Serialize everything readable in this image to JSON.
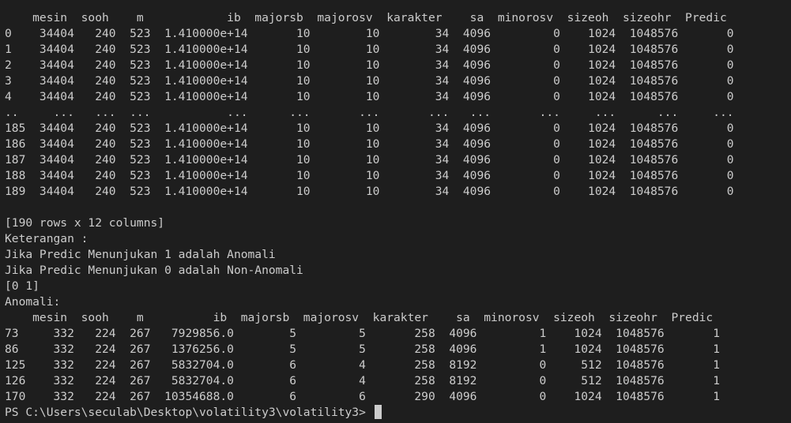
{
  "terminal": {
    "lines": [
      "    mesin  sooh    m            ib  majorsb  majorosv  karakter    sa  minorosv  sizeoh  sizeohr  Predic",
      "0    34404   240  523  1.410000e+14       10        10        34  4096         0    1024  1048576       0",
      "1    34404   240  523  1.410000e+14       10        10        34  4096         0    1024  1048576       0",
      "2    34404   240  523  1.410000e+14       10        10        34  4096         0    1024  1048576       0",
      "3    34404   240  523  1.410000e+14       10        10        34  4096         0    1024  1048576       0",
      "4    34404   240  523  1.410000e+14       10        10        34  4096         0    1024  1048576       0",
      "..     ...   ...  ...           ...      ...       ...       ...   ...       ...     ...      ...     ...",
      "185  34404   240  523  1.410000e+14       10        10        34  4096         0    1024  1048576       0",
      "186  34404   240  523  1.410000e+14       10        10        34  4096         0    1024  1048576       0",
      "187  34404   240  523  1.410000e+14       10        10        34  4096         0    1024  1048576       0",
      "188  34404   240  523  1.410000e+14       10        10        34  4096         0    1024  1048576       0",
      "189  34404   240  523  1.410000e+14       10        10        34  4096         0    1024  1048576       0",
      "",
      "[190 rows x 12 columns]",
      "Keterangan :",
      "Jika Predic Menunjukan 1 adalah Anomali",
      "Jika Predic Menunjukan 0 adalah Non-Anomali",
      "[0 1]",
      "Anomali:",
      "    mesin  sooh    m          ib  majorsb  majorosv  karakter    sa  minorosv  sizeoh  sizeohr  Predic",
      "73     332   224  267   7929856.0        5         5       258  4096         1    1024  1048576       1",
      "86     332   224  267   1376256.0        5         5       258  4096         1    1024  1048576       1",
      "125    332   224  267   5832704.0        6         4       258  8192         0     512  1048576       1",
      "126    332   224  267   5832704.0        6         4       258  8192         0     512  1048576       1",
      "170    332   224  267  10354688.0        6         6       290  4096         0    1024  1048576       1"
    ],
    "prompt": "PS C:\\Users\\seculab\\Desktop\\volatility3\\volatility3> "
  }
}
